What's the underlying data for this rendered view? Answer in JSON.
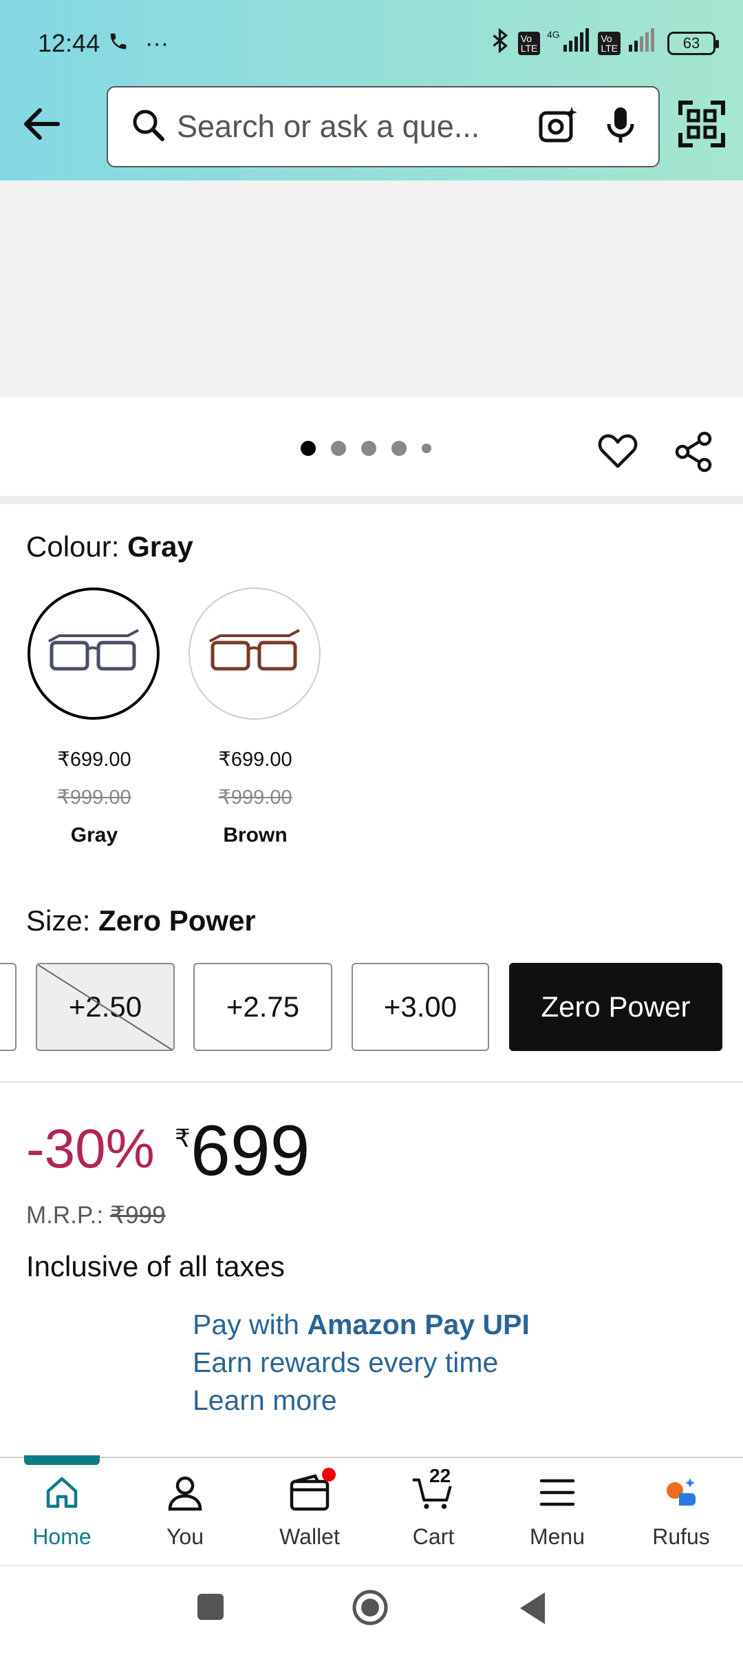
{
  "status_bar": {
    "time": "12:44",
    "battery": "63"
  },
  "search": {
    "placeholder": "Search or ask a que..."
  },
  "carousel": {
    "total": 5,
    "active_index": 1
  },
  "colour": {
    "label": "Colour:",
    "selected": "Gray",
    "options": [
      {
        "price": "₹699.00",
        "mrp": "₹999.00",
        "name": "Gray"
      },
      {
        "price": "₹699.00",
        "mrp": "₹999.00",
        "name": "Brown"
      }
    ]
  },
  "size": {
    "label": "Size:",
    "selected": "Zero Power",
    "options": [
      "+2.50",
      "+2.75",
      "+3.00",
      "Zero Power"
    ]
  },
  "pricing": {
    "discount": "-30%",
    "currency": "₹",
    "price": "699",
    "mrp_label": "M.R.P.:",
    "mrp": "₹999",
    "taxes": "Inclusive of all taxes"
  },
  "amazon_pay": {
    "line1_prefix": "Pay with ",
    "line1_bold": "Amazon Pay UPI",
    "line2": "Earn rewards every time",
    "line3": "Learn more"
  },
  "bottom_nav": {
    "home": "Home",
    "you": "You",
    "wallet": "Wallet",
    "cart": "Cart",
    "cart_count": "22",
    "menu": "Menu",
    "rufus": "Rufus"
  },
  "colors": {
    "accent": "#0e7c86",
    "discount": "#b12652",
    "link": "#2a6496"
  }
}
